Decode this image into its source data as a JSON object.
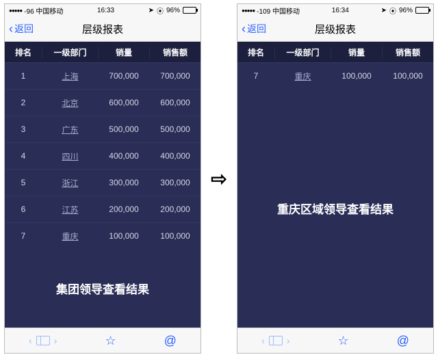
{
  "phones": [
    {
      "status": {
        "signal_text": "-96 中国移动",
        "time": "16:33",
        "battery_pct": "96%"
      },
      "nav": {
        "back_label": "返回",
        "title": "层级报表"
      },
      "columns": [
        "排名",
        "一级部门",
        "销量",
        "销售额"
      ],
      "rows": [
        {
          "rank": "1",
          "dept": "上海",
          "qty": "700,000",
          "amt": "700,000"
        },
        {
          "rank": "2",
          "dept": "北京",
          "qty": "600,000",
          "amt": "600,000"
        },
        {
          "rank": "3",
          "dept": "广东",
          "qty": "500,000",
          "amt": "500,000"
        },
        {
          "rank": "4",
          "dept": "四川",
          "qty": "400,000",
          "amt": "400,000"
        },
        {
          "rank": "5",
          "dept": "浙江",
          "qty": "300,000",
          "amt": "300,000"
        },
        {
          "rank": "6",
          "dept": "江苏",
          "qty": "200,000",
          "amt": "200,000"
        },
        {
          "rank": "7",
          "dept": "重庆",
          "qty": "100,000",
          "amt": "100,000"
        }
      ],
      "caption": "集团领导查看结果"
    },
    {
      "status": {
        "signal_text": "-109 中国移动",
        "time": "16:34",
        "battery_pct": "96%"
      },
      "nav": {
        "back_label": "返回",
        "title": "层级报表"
      },
      "columns": [
        "排名",
        "一级部门",
        "销量",
        "销售额"
      ],
      "rows": [
        {
          "rank": "7",
          "dept": "重庆",
          "qty": "100,000",
          "amt": "100,000"
        }
      ],
      "caption": "重庆区域领导查看结果"
    }
  ],
  "arrow_glyph": "⇨",
  "icons": {
    "location": "➤",
    "alarm": "⏰",
    "star": "☆",
    "at": "@",
    "chevron_left": "‹",
    "chevron_right": "›"
  }
}
